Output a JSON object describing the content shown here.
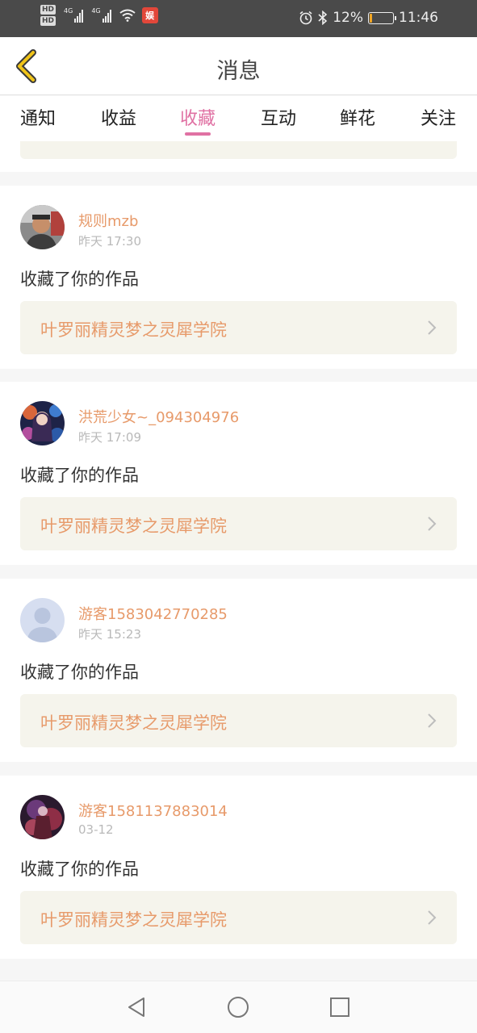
{
  "status_bar": {
    "hd_badges": [
      "HD",
      "HD"
    ],
    "network_labels": [
      "4G",
      "4G"
    ],
    "app_badge": "娱",
    "battery_percent": "12%",
    "battery_level": 0.12,
    "time": "11:46",
    "icons": [
      "alarm-icon",
      "bluetooth-icon",
      "battery-icon",
      "wifi-icon"
    ]
  },
  "header": {
    "title": "消息",
    "back_icon": "chevron-left-icon",
    "accent_color": "#f0c419"
  },
  "tabs": {
    "items": [
      {
        "label": "通知"
      },
      {
        "label": "收益"
      },
      {
        "label": "收藏"
      },
      {
        "label": "互动"
      },
      {
        "label": "鲜花"
      },
      {
        "label": "关注"
      }
    ],
    "active_index": 2,
    "active_color": "#e071a3"
  },
  "messages": [
    {
      "username": "规则mzb",
      "time": "昨天 17:30",
      "action": "收藏了你的作品",
      "work_title": "叶罗丽精灵梦之灵犀学院"
    },
    {
      "username": "洪荒少女~_094304976",
      "time": "昨天 17:09",
      "action": "收藏了你的作品",
      "work_title": "叶罗丽精灵梦之灵犀学院"
    },
    {
      "username": "游客1583042770285",
      "time": "昨天 15:23",
      "action": "收藏了你的作品",
      "work_title": "叶罗丽精灵梦之灵犀学院"
    },
    {
      "username": "游客1581137883014",
      "time": "03-12",
      "action": "收藏了你的作品",
      "work_title": "叶罗丽精灵梦之灵犀学院"
    }
  ],
  "colors": {
    "username": "#e79a6a",
    "link_bg": "#f5f4ec"
  },
  "nav": {
    "icons": [
      "back-triangle-icon",
      "home-circle-icon",
      "recents-square-icon"
    ]
  }
}
